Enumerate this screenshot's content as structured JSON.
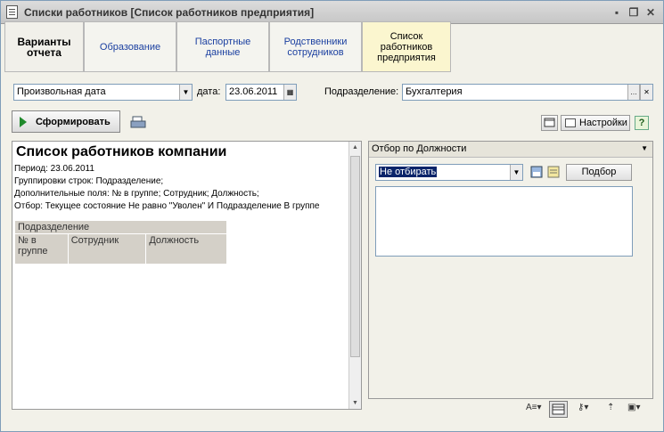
{
  "window": {
    "title": "Списки работников [Список работников предприятия]"
  },
  "tabs": [
    {
      "label": "Варианты\nотчета",
      "style": "bold"
    },
    {
      "label": "Образование"
    },
    {
      "label": "Паспортные\nданные"
    },
    {
      "label": "Родственники\nсотрудников"
    },
    {
      "label": "Список\nработников\nпредприятия",
      "active": true
    }
  ],
  "params": {
    "date_mode": "Произвольная дата",
    "date_label": "дата:",
    "date_value": "23.06.2011",
    "subdivision_label": "Подразделение:",
    "subdivision_value": "Бухгалтерия"
  },
  "toolbar": {
    "generate_label": "Сформировать",
    "settings_label": "Настройки",
    "help_label": "?"
  },
  "report": {
    "title": "Список работников компании",
    "period": "Период: 23.06.2011",
    "grouping": "Группировки строк: Подразделение;",
    "extra_fields": "Дополнительные поля: № в группе; Сотрудник; Должность;",
    "filter": "Отбор: Текущее состояние Не равно \"Уволен\" И Подразделение В группе",
    "table": {
      "group_header": "Подразделение",
      "columns": [
        "№ в группе",
        "Сотрудник",
        "Должность"
      ]
    }
  },
  "filter_panel": {
    "header": "Отбор по Должности",
    "selected": "Не отбирать",
    "pick_button": "Подбор"
  }
}
